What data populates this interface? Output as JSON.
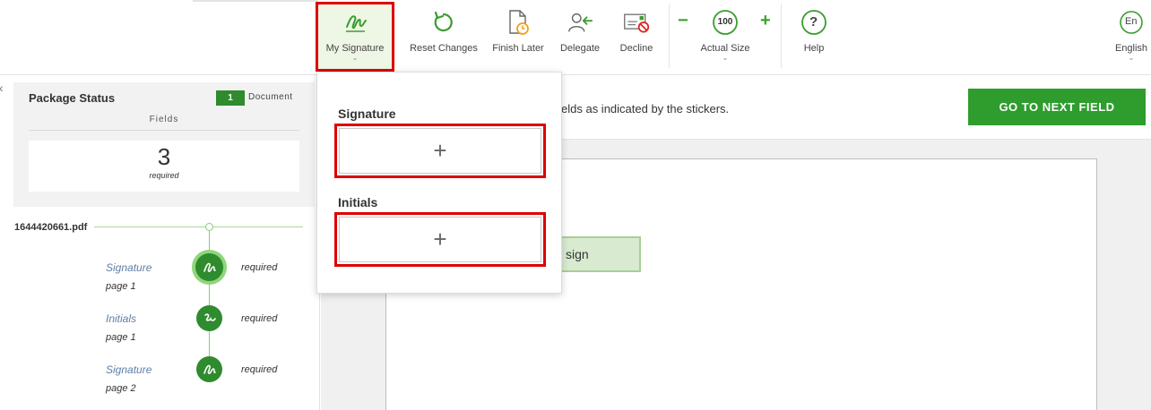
{
  "toolbar": {
    "my_signature": "My Signature",
    "reset_changes": "Reset Changes",
    "finish_later": "Finish Later",
    "delegate": "Delegate",
    "decline": "Decline",
    "zoom_minus": "−",
    "zoom_level": "100",
    "zoom_plus": "+",
    "actual_size": "Actual Size",
    "help_glyph": "?",
    "help": "Help",
    "language_badge": "En",
    "language": "English",
    "chevron": "⌄"
  },
  "package_status": {
    "collapse_glyph": "‹",
    "title": "Package Status",
    "document_count": "1",
    "document_label": "Document",
    "fields_label": "Fields",
    "required_count": "3",
    "required_label": "required"
  },
  "file": {
    "name": "1644420661.pdf",
    "fields": [
      {
        "name": "Signature",
        "page": "page 1",
        "status": "required"
      },
      {
        "name": "Initials",
        "page": "page 1",
        "status": "required"
      },
      {
        "name": "Signature",
        "page": "page 2",
        "status": "required"
      }
    ]
  },
  "content": {
    "instruction": "elds as indicated by the stickers.",
    "next_button": "GO TO NEXT FIELD",
    "sticker_label": "sign"
  },
  "popup": {
    "signature_title": "Signature",
    "initials_title": "Initials",
    "add_glyph": "+"
  },
  "colors": {
    "accent_green": "#2e9d2e",
    "highlight_red": "#dd0000"
  }
}
